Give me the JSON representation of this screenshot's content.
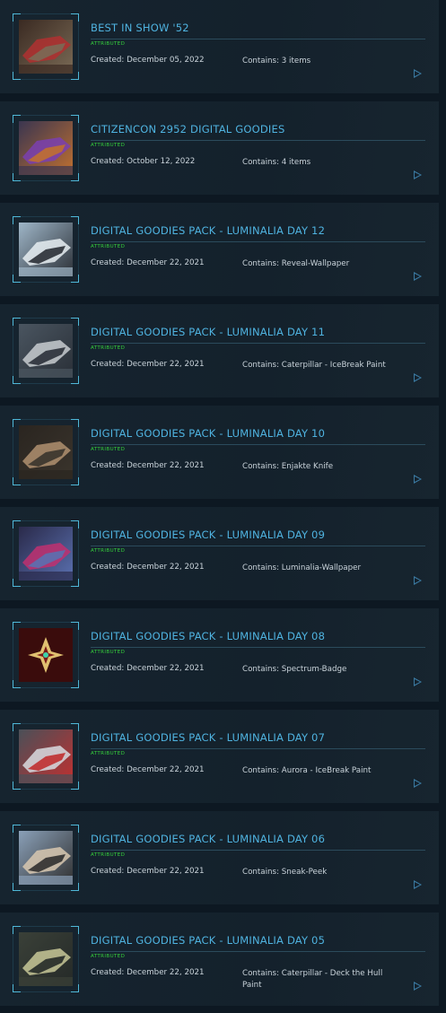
{
  "items": [
    {
      "title": "BEST IN SHOW '52",
      "status": "ATTRIBUTED",
      "created": "Created: December 05, 2022",
      "contains": "Contains: 3 items",
      "thumb": "ship-model-icon",
      "colors": [
        "#3a2a22",
        "#b03030",
        "#7a6a55"
      ]
    },
    {
      "title": "CITIZENCON 2952 DIGITAL GOODIES",
      "status": "ATTRIBUTED",
      "created": "Created: October 12, 2022",
      "contains": "Contains: 4 items",
      "thumb": "armor-icon",
      "colors": [
        "#3a3550",
        "#7a40b0",
        "#c07030"
      ]
    },
    {
      "title": "DIGITAL GOODIES PACK - LUMINALIA DAY 12",
      "status": "ATTRIBUTED",
      "created": "Created: December 22, 2021",
      "contains": "Contains: Reveal-Wallpaper",
      "thumb": "snow-ship-icon",
      "colors": [
        "#9fb6c8",
        "#e8eef2",
        "#2a2f36"
      ]
    },
    {
      "title": "DIGITAL GOODIES PACK - LUMINALIA DAY 11",
      "status": "ATTRIBUTED",
      "created": "Created: December 22, 2021",
      "contains": "Contains: Caterpillar - IceBreak Paint",
      "thumb": "caterpillar-ship-icon",
      "colors": [
        "#4a5560",
        "#c8ccd0",
        "#2a3038"
      ]
    },
    {
      "title": "DIGITAL GOODIES PACK - LUMINALIA DAY 10",
      "status": "ATTRIBUTED",
      "created": "Created: December 22, 2021",
      "contains": "Contains: Enjakte Knife",
      "thumb": "knife-icon",
      "colors": [
        "#2a2520",
        "#b09070",
        "#3a342c"
      ]
    },
    {
      "title": "DIGITAL GOODIES PACK - LUMINALIA DAY 09",
      "status": "ATTRIBUTED",
      "created": "Created: December 22, 2021",
      "contains": "Contains: Luminalia-Wallpaper",
      "thumb": "wallpaper-icon",
      "colors": [
        "#2a2a4a",
        "#c03070",
        "#5a70b0"
      ]
    },
    {
      "title": "DIGITAL GOODIES PACK - LUMINALIA DAY 08",
      "status": "ATTRIBUTED",
      "created": "Created: December 22, 2021",
      "contains": "Contains: Spectrum-Badge",
      "thumb": "badge-icon",
      "colors": [
        "#3a0c0c",
        "#e0c070",
        "#7a1818"
      ]
    },
    {
      "title": "DIGITAL GOODIES PACK - LUMINALIA DAY 07",
      "status": "ATTRIBUTED",
      "created": "Created: December 22, 2021",
      "contains": "Contains: Aurora - IceBreak Paint",
      "thumb": "aurora-ship-icon",
      "colors": [
        "#4a5058",
        "#d8dce0",
        "#c03030"
      ]
    },
    {
      "title": "DIGITAL GOODIES PACK - LUMINALIA DAY 06",
      "status": "ATTRIBUTED",
      "created": "Created: December 22, 2021",
      "contains": "Contains: Sneak-Peek",
      "thumb": "sneak-peek-icon",
      "colors": [
        "#8aa0b8",
        "#d8c8b0",
        "#303030"
      ]
    },
    {
      "title": "DIGITAL GOODIES PACK - LUMINALIA DAY 05",
      "status": "ATTRIBUTED",
      "created": "Created: December 22, 2021",
      "contains": "Contains: Caterpillar - Deck the Hull Paint",
      "thumb": "hull-paint-icon",
      "colors": [
        "#3a4038",
        "#c8c898",
        "#252a28"
      ]
    }
  ]
}
